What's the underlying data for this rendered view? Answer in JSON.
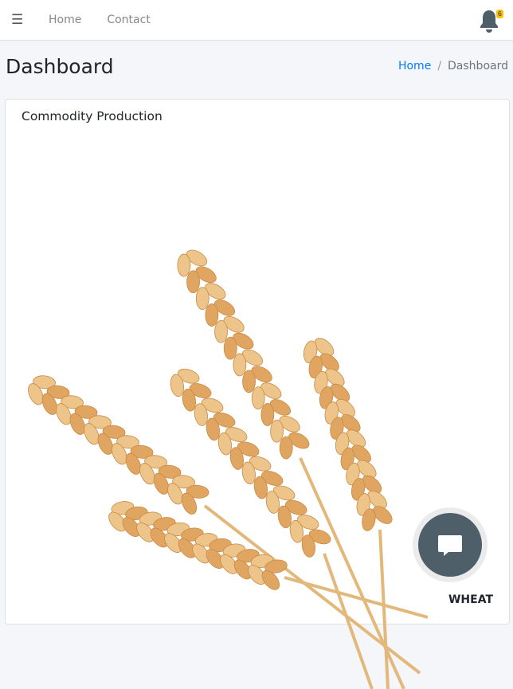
{
  "nav": {
    "links": [
      "Home",
      "Contact"
    ],
    "notification_count": "6"
  },
  "header": {
    "title": "Dashboard",
    "breadcrumb": [
      "Home",
      "Dashboard"
    ]
  },
  "card": {
    "title": "Commodity Production",
    "commodity_label": "WHEAT"
  },
  "colors": {
    "accent": "#007bff",
    "badge": "#ffc107",
    "chat": "#4f5f6a"
  }
}
